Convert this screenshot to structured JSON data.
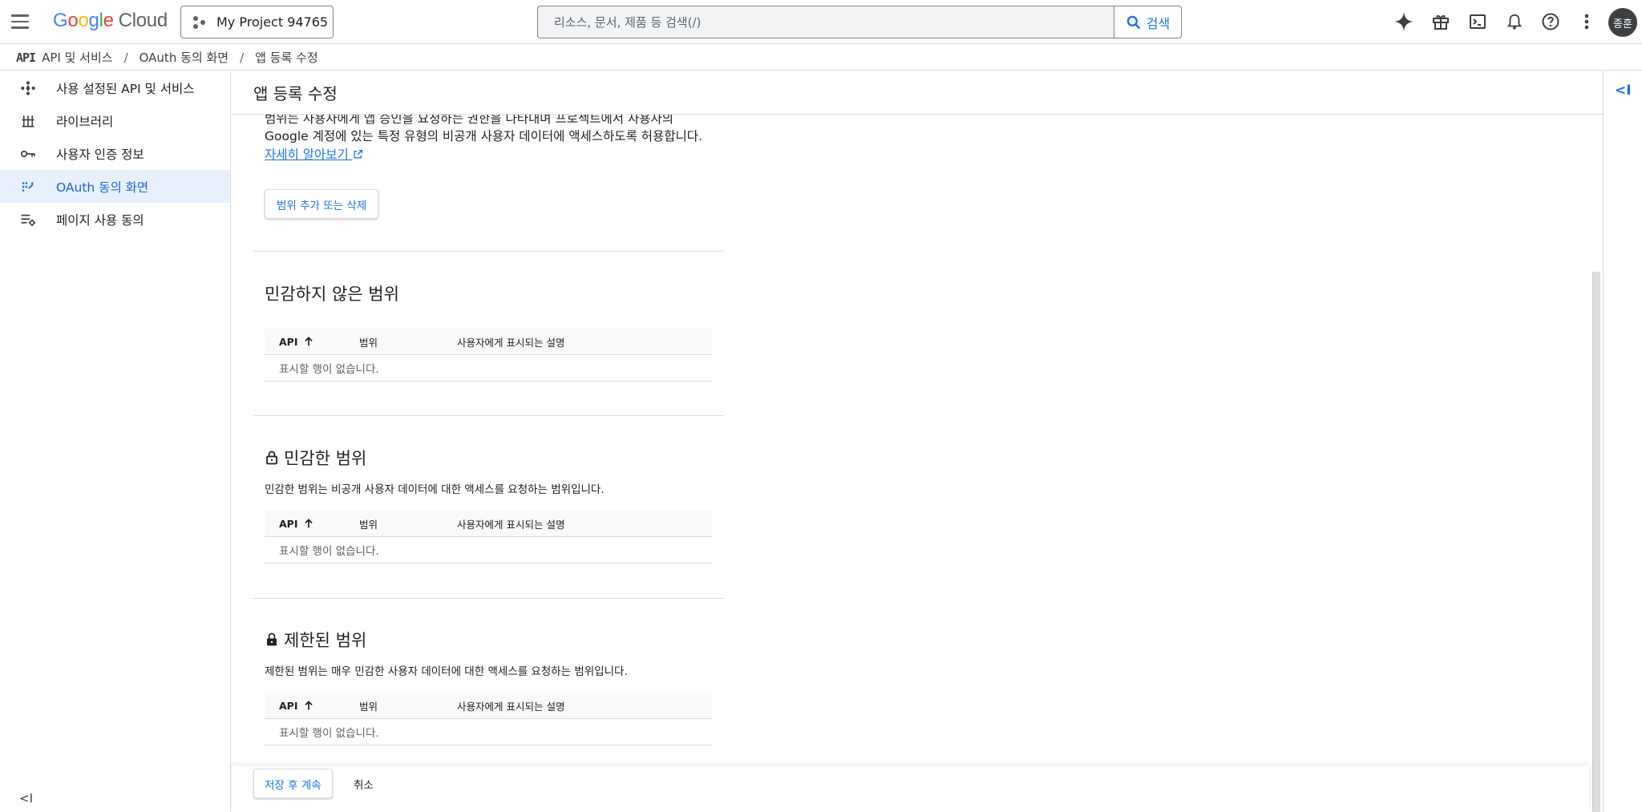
{
  "header": {
    "logo_google": [
      "G",
      "o",
      "o",
      "g",
      "l",
      "e"
    ],
    "logo_cloud": "Cloud",
    "project_name": "My Project 94765",
    "search_placeholder": "리소스, 문서, 제품 등 검색(/)",
    "search_button": "검색",
    "avatar_initials": "종훈"
  },
  "breadcrumb": {
    "api_logo": "API",
    "items": [
      "API 및 서비스",
      "OAuth 동의 화면",
      "앱 등록 수정"
    ]
  },
  "sidebar": {
    "items": [
      {
        "label": "사용 설정된 API 및 서비스",
        "icon": "api-diamond-icon"
      },
      {
        "label": "라이브러리",
        "icon": "library-icon"
      },
      {
        "label": "사용자 인증 정보",
        "icon": "key-icon"
      },
      {
        "label": "OAuth 동의 화면",
        "icon": "oauth-consent-icon",
        "active": true
      },
      {
        "label": "페이지 사용 동의",
        "icon": "page-usage-icon"
      }
    ],
    "collapse_label": "<I"
  },
  "main": {
    "title": "앱 등록 수정",
    "intro_line1": "범위는 사용자에게 앱 승인을 요청하는 권한을 나타내며 프로젝트에서 사용자의",
    "intro_line2": "Google 계정에 있는 특정 유형의 비공개 사용자 데이터에 액세스하도록 허용합니다.",
    "learn_more": "자세히 알아보기",
    "add_remove_button": "범위 추가 또는 삭제",
    "sections": [
      {
        "title": "민감하지 않은 범위",
        "description": ""
      },
      {
        "title": "민감한 범위",
        "description": "민감한 범위는 비공개 사용자 데이터에 대한 액세스를 요청하는 범위입니다."
      },
      {
        "title": "제한된 범위",
        "description": "제한된 범위는 매우 민감한 사용자 데이터에 대한 액세스를 요청하는 범위입니다."
      }
    ],
    "table_columns": [
      "API",
      "범위",
      "사용자에게 표시되는 설명"
    ],
    "empty_text": "표시할 행이 없습니다.",
    "save_button": "저장 후 계속",
    "cancel_button": "취소"
  },
  "right_rail": {
    "collapse_label": "<I"
  },
  "colors": {
    "accent": "#1a73e8",
    "active_bg": "#e8f0fe",
    "border": "#dadce0"
  }
}
